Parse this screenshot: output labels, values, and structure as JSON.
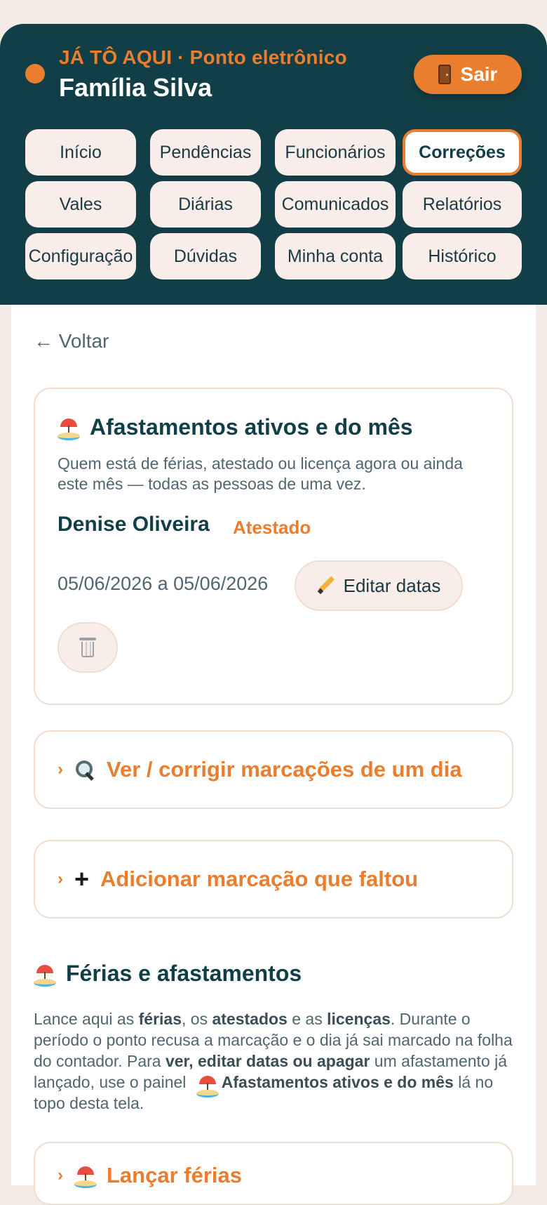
{
  "header": {
    "subtitle": "JÁ TÔ AQUI · Ponto eletrônico",
    "title": "Família Silva",
    "logout_label": "Sair"
  },
  "nav": {
    "items": [
      {
        "label": "Início"
      },
      {
        "label": "Pendências"
      },
      {
        "label": "Funcionários"
      },
      {
        "label": "Correções",
        "active": true
      },
      {
        "label": "Vales"
      },
      {
        "label": "Diárias"
      },
      {
        "label": "Comunicados"
      },
      {
        "label": "Relatórios"
      },
      {
        "label": "Configuração"
      },
      {
        "label": "Dúvidas"
      },
      {
        "label": "Minha conta"
      },
      {
        "label": "Histórico"
      }
    ]
  },
  "back": {
    "label": "← Voltar"
  },
  "active_leaves": {
    "title": "Afastamentos ativos e do mês",
    "description": "Quem está de férias, atestado ou licença agora ou ainda este mês — todas as pessoas de uma vez.",
    "entries": [
      {
        "name": "Denise Oliveira",
        "type": "Atestado",
        "range": "05/06/2026 a 05/06/2026",
        "edit_label": "Editar datas"
      }
    ]
  },
  "sections": {
    "view_fix": {
      "label": "Ver / corrigir marcações de um dia"
    },
    "add_missing": {
      "label": "Adicionar marcação que faltou"
    }
  },
  "vacation": {
    "title": "Férias e afastamentos",
    "desc_parts": {
      "p1": "Lance aqui as ",
      "b1": "férias",
      "p2": ", os ",
      "b2": "atestados",
      "p3": " e as ",
      "b3": "licenças",
      "p4": ". Durante o período o ponto recusa a marcação e o dia já sai marcado na folha do contador. Para ",
      "b4": "ver, editar datas ou apagar",
      "p5": " um afastamento já lançado, use o painel ",
      "b5": "Afastamentos ativos e do mês",
      "p6": " lá no topo desta tela."
    },
    "launch_label": "Lançar férias"
  },
  "colors": {
    "header_bg": "#123f47",
    "accent": "#ea7d2e",
    "page_bg": "#f5ebe6",
    "pill_bg": "#f8ede8"
  },
  "icons": [
    "door-icon",
    "umbrella-beach-icon",
    "pencil-icon",
    "trash-icon",
    "magnify-icon",
    "plus-icon",
    "chevron-right-icon"
  ]
}
